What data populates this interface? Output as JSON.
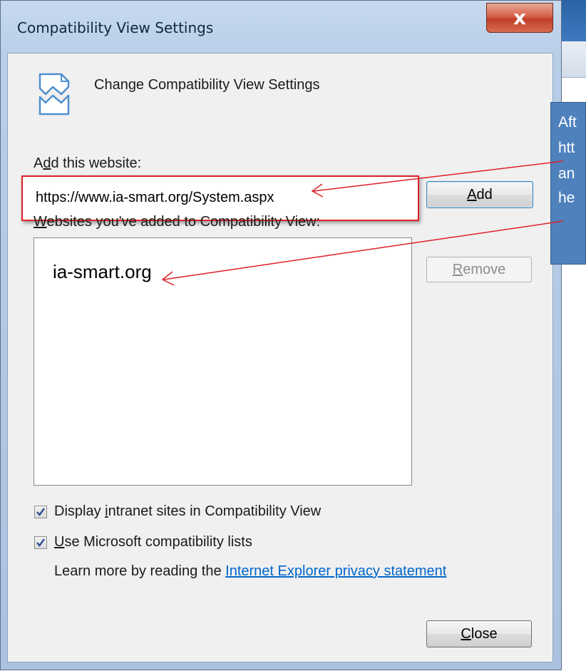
{
  "dialog": {
    "title": "Compatibility View Settings",
    "close_glyph": "x",
    "header": "Change Compatibility View Settings"
  },
  "add_section": {
    "label_first": "A",
    "label_underlined": "d",
    "label_rest": "d this website:",
    "input_value": "https://www.ia-smart.org/System.aspx",
    "add_button_underlined": "A",
    "add_button_rest": "dd"
  },
  "sites_section": {
    "label_underlined": "W",
    "label_rest": "ebsites you've added to Compatibility View:",
    "items": [
      "ia-smart.org"
    ],
    "remove_button_underlined": "R",
    "remove_button_rest": "emove"
  },
  "options": {
    "intranet_label_first": "Display ",
    "intranet_label_underlined": "i",
    "intranet_label_rest": "ntranet sites in Compatibility View",
    "intranet_checked": true,
    "mslists_label_underlined": "U",
    "mslists_label_rest": "se Microsoft compatibility lists",
    "mslists_checked": true,
    "learn_more_text": "Learn more by reading the ",
    "privacy_link": "Internet Explorer privacy statement"
  },
  "footer": {
    "close_button_underlined": "C",
    "close_button_rest": "lose"
  },
  "callout": {
    "lines": [
      "Aft",
      "htt",
      "an",
      "he"
    ],
    "color": "#4f81bd"
  },
  "colors": {
    "highlight_border": "#e01f26",
    "arrow": "#e01f26",
    "link": "#0066cc"
  }
}
